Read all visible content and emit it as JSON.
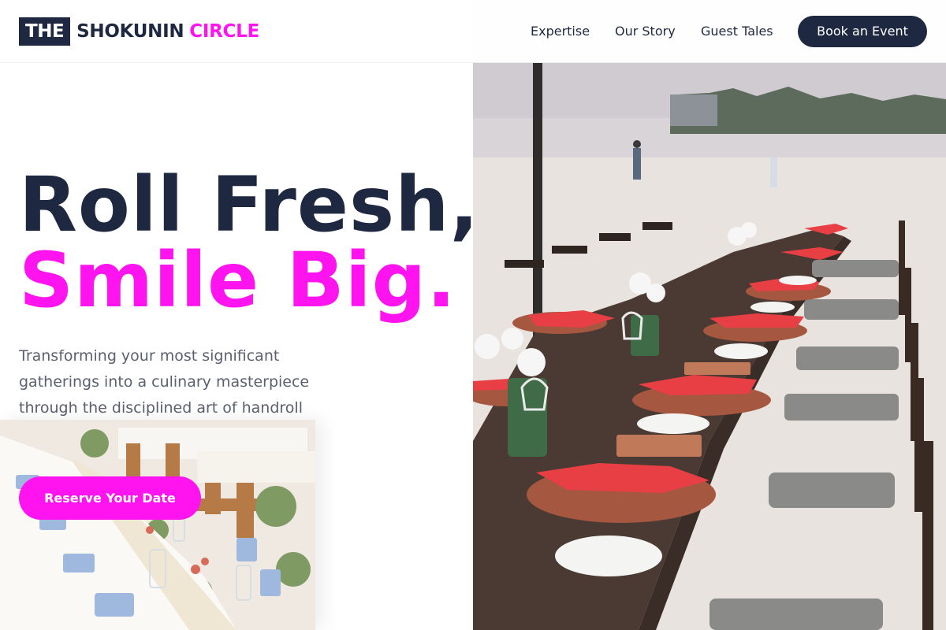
{
  "brand": {
    "logo_prefix": "THE",
    "logo_word": "SHOKUNIN",
    "logo_accent": "CIRCLE",
    "accent_color": "#ff14f0",
    "dark_color": "#1e2840"
  },
  "nav": {
    "links": [
      "Expertise",
      "Our Story",
      "Guest Tales"
    ],
    "cta_label": "Book an Event"
  },
  "hero": {
    "headline_line1": "Roll Fresh,",
    "headline_line2": "Smile Big.",
    "description": "Transforming your most significant gatherings into a culinary masterpiece through the disciplined art of handroll catering.",
    "cta_label": "Reserve Your Date"
  },
  "images": {
    "main": "beach dinner table photo",
    "secondary": "banquet table photo"
  }
}
